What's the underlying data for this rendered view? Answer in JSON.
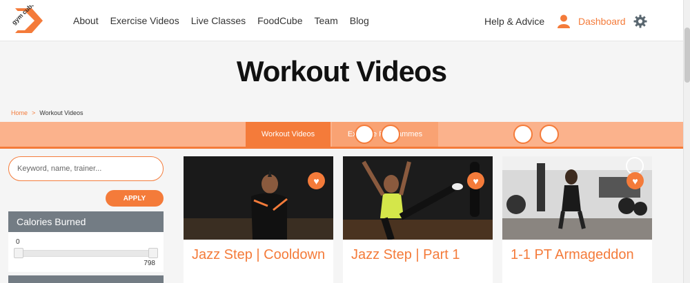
{
  "logo": {
    "text": "gym cube"
  },
  "nav": [
    {
      "label": "About"
    },
    {
      "label": "Exercise Videos"
    },
    {
      "label": "Live Classes"
    },
    {
      "label": "FoodCube"
    },
    {
      "label": "Team"
    },
    {
      "label": "Blog"
    }
  ],
  "header_right": {
    "help_label": "Help & Advice",
    "dashboard_label": "Dashboard"
  },
  "hero": {
    "title": "Workout Videos"
  },
  "breadcrumb": {
    "home": "Home",
    "separator": ">",
    "current": "Workout Videos"
  },
  "tabs": [
    {
      "label": "Workout Videos",
      "active": true
    },
    {
      "label": "Exercise Programmes",
      "active": false
    }
  ],
  "sidebar": {
    "search_placeholder": "Keyword, name, trainer...",
    "apply_label": "APPLY",
    "calories_title": "Calories Burned",
    "calories_min": "0",
    "calories_max": "798"
  },
  "cards": [
    {
      "title": "Jazz Step | Cooldown"
    },
    {
      "title": "Jazz Step | Part 1"
    },
    {
      "title": "1-1 PT Armageddon"
    }
  ],
  "colors": {
    "accent": "#f47b3a",
    "accent_light": "#fbb28c",
    "filter_gray": "#737c84"
  }
}
